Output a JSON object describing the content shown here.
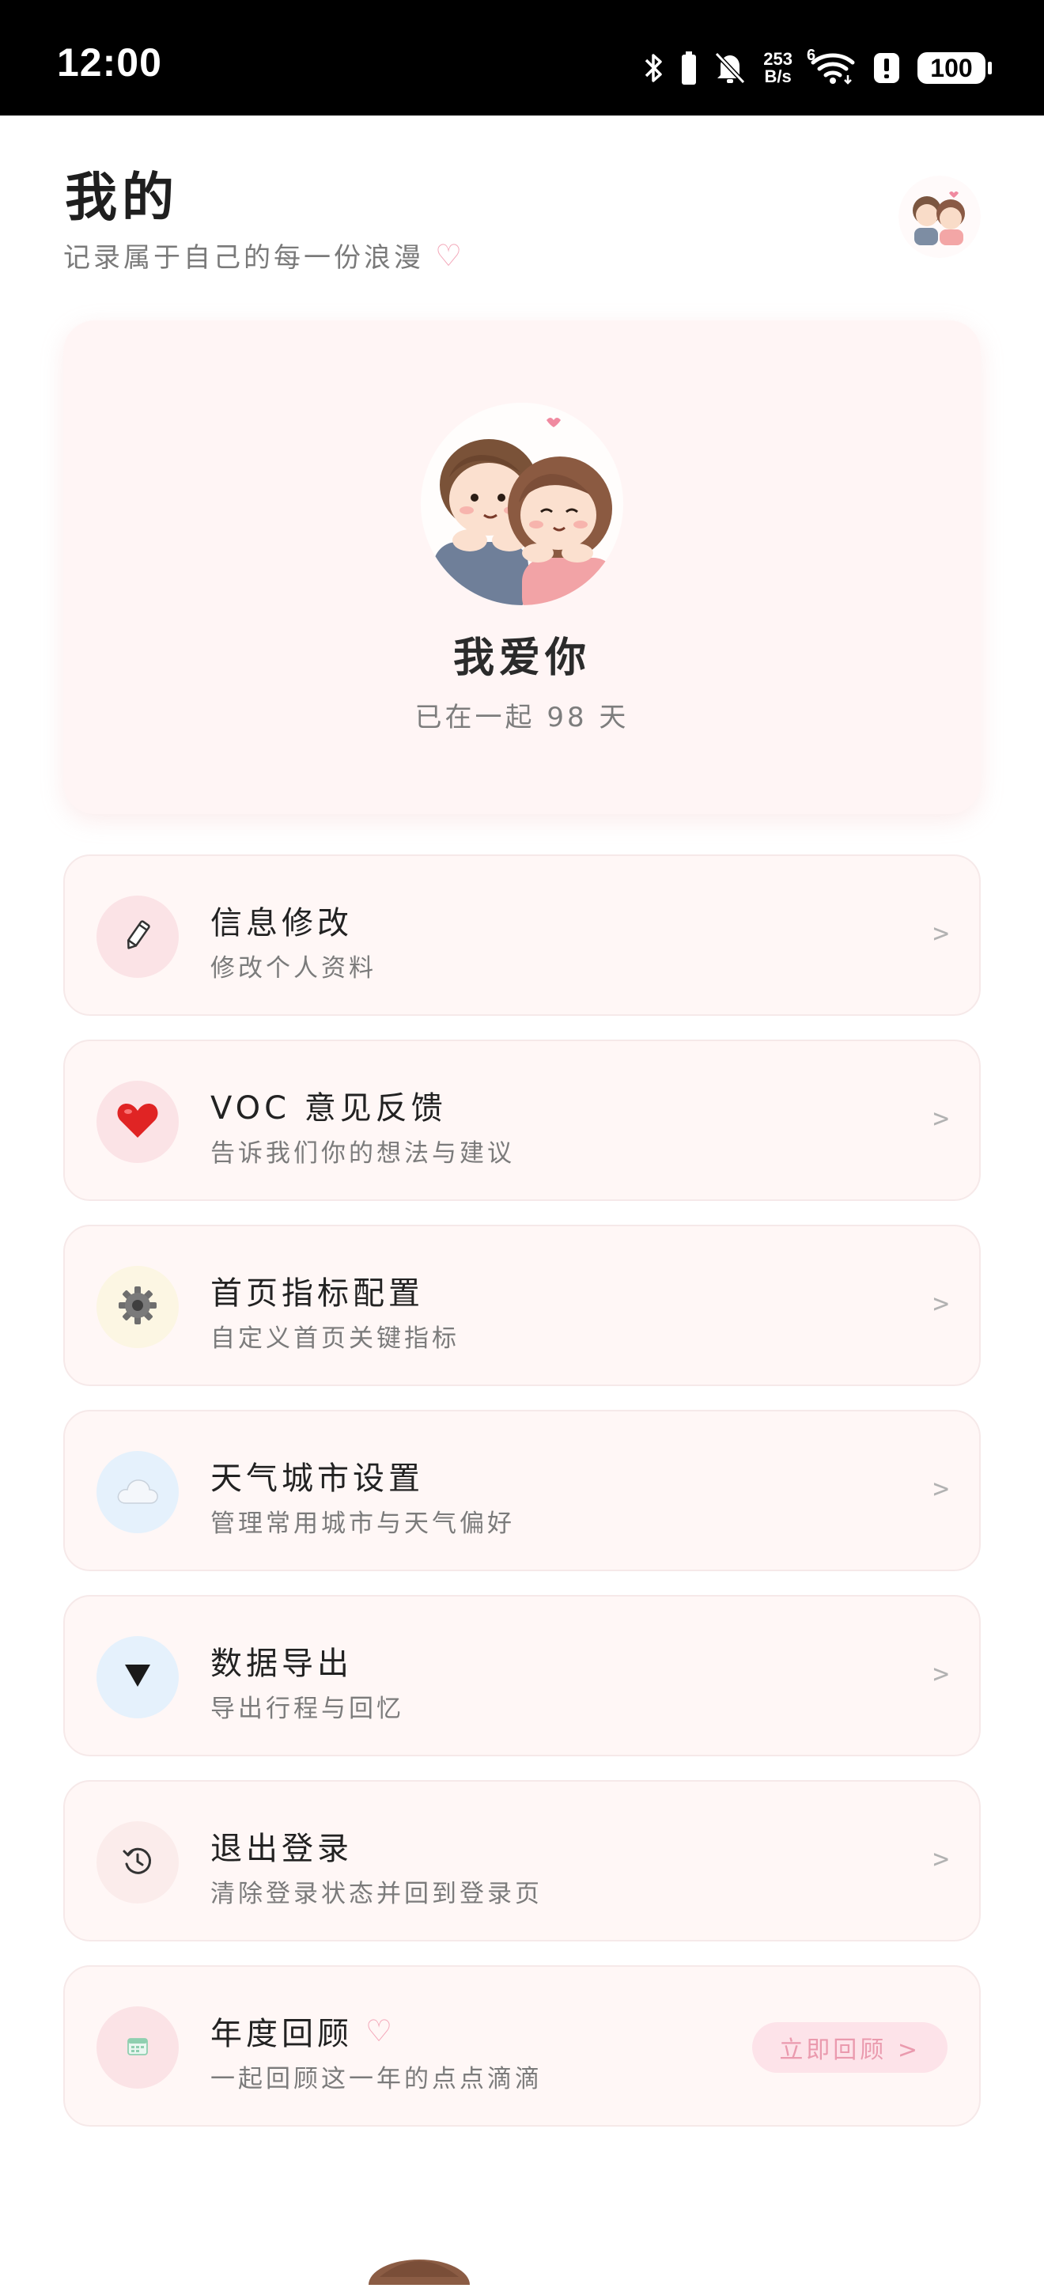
{
  "status_bar": {
    "time": "12:00",
    "net_speed_value": "253",
    "net_speed_unit": "B/s",
    "wifi_label": "6",
    "battery": "100",
    "icons": [
      "bluetooth-icon",
      "battery-saver-icon",
      "mute-icon",
      "wifi-icon",
      "alert-icon",
      "battery-icon"
    ]
  },
  "header": {
    "title": "我的",
    "subtitle": "记录属于自己的每一份浪漫",
    "subtitle_icon": "♡"
  },
  "profile": {
    "name": "我爱你",
    "days_text": "已在一起 98 天"
  },
  "menu": {
    "items": [
      {
        "title": "信息修改",
        "subtitle": "修改个人资料",
        "icon": "pencil-icon",
        "icon_bg": "#fbe3e6",
        "chevron": ">"
      },
      {
        "title": "VOC 意见反馈",
        "subtitle": "告诉我们你的想法与建议",
        "icon": "heart-icon",
        "icon_bg": "#fbe3e6",
        "chevron": ">"
      },
      {
        "title": "首页指标配置",
        "subtitle": "自定义首页关键指标",
        "icon": "gear-icon",
        "icon_bg": "#fcf6e3",
        "chevron": ">"
      },
      {
        "title": "天气城市设置",
        "subtitle": "管理常用城市与天气偏好",
        "icon": "cloud-icon",
        "icon_bg": "#e5f1fc",
        "chevron": ">"
      },
      {
        "title": "数据导出",
        "subtitle": "导出行程与回忆",
        "icon": "download-triangle-icon",
        "icon_bg": "#e5f1fc",
        "chevron": ">"
      },
      {
        "title": "退出登录",
        "subtitle": "清除登录状态并回到登录页",
        "icon": "logout-clock-icon",
        "icon_bg": "#fbeceb",
        "chevron": ">"
      },
      {
        "title": "年度回顾",
        "title_icon": "♡",
        "subtitle": "一起回顾这一年的点点滴滴",
        "icon": "calendar-icon",
        "icon_bg": "#fbe3e6",
        "button": "立即回顾 >"
      }
    ]
  },
  "colors": {
    "accent_pink": "#f3a6b8",
    "card_bg": "#fff5f5",
    "heart_red": "#e02424"
  }
}
